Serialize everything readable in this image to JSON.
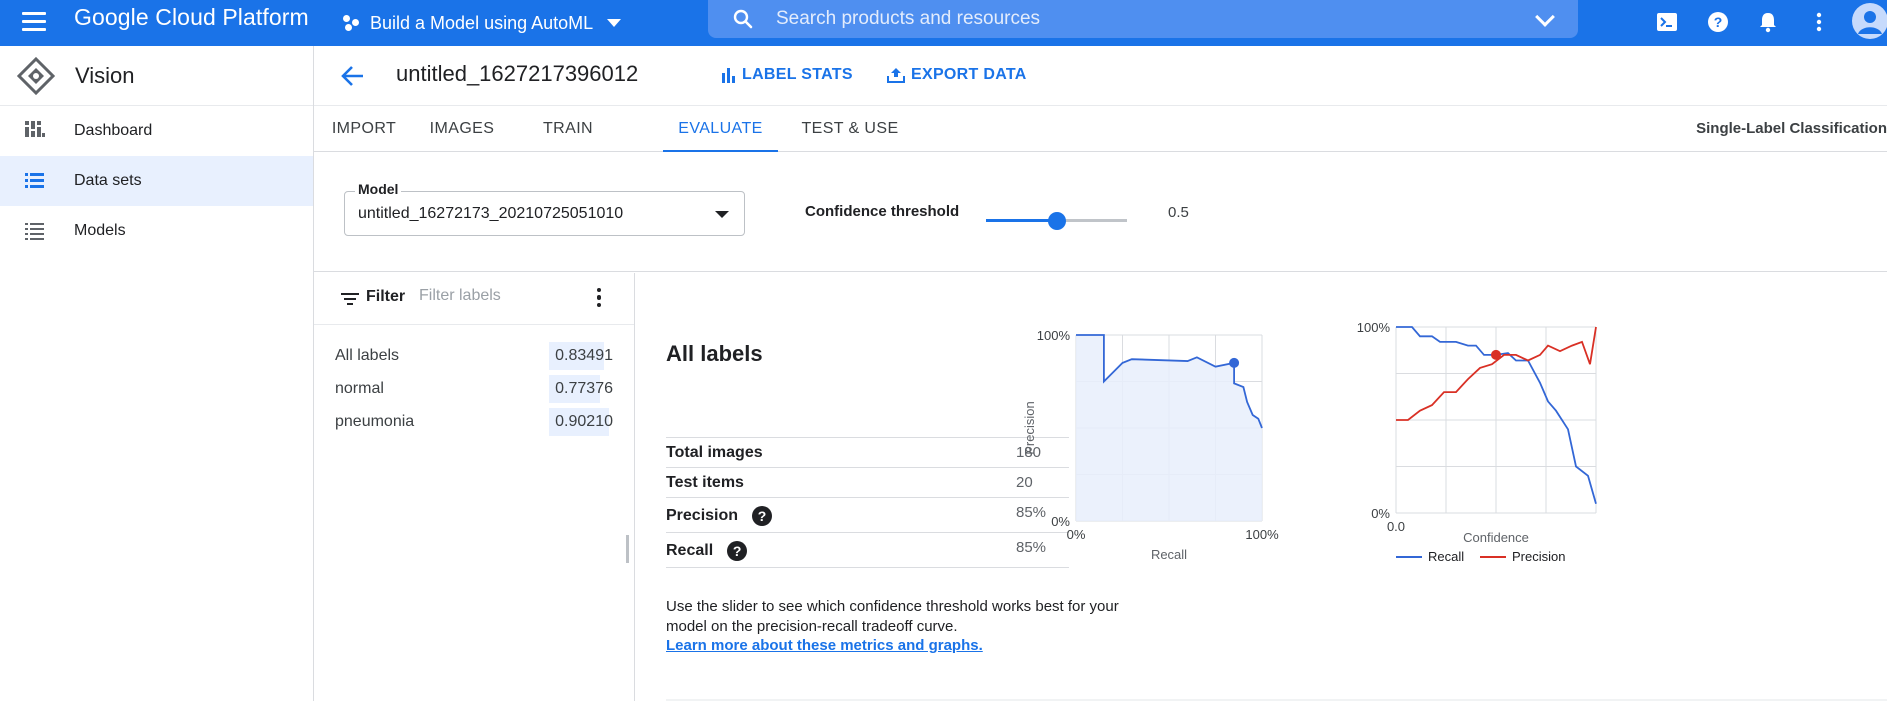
{
  "topbar": {
    "brand": "Google Cloud Platform",
    "project": "Build a Model using AutoML",
    "search_placeholder": "Search products and resources",
    "icons": [
      "cloud-shell-icon",
      "help-icon",
      "notifications-icon",
      "more-vert-icon",
      "account-avatar-icon"
    ],
    "color": "#1a73e8"
  },
  "leftnav": {
    "title": "Vision",
    "items": [
      {
        "label": "Dashboard",
        "icon": "dashboard-icon",
        "active": false
      },
      {
        "label": "Data sets",
        "icon": "datasets-icon",
        "active": true
      },
      {
        "label": "Models",
        "icon": "models-icon",
        "active": false
      }
    ]
  },
  "header": {
    "dataset_title": "untitled_1627217396012",
    "label_stats": "LABEL STATS",
    "export_data": "EXPORT DATA"
  },
  "tabs": {
    "items": [
      "IMPORT",
      "IMAGES",
      "TRAIN",
      "EVALUATE",
      "TEST & USE"
    ],
    "active": "EVALUATE",
    "right_label": "Single-Label Classification"
  },
  "model": {
    "label": "Model",
    "value": "untitled_16272173_20210725051010",
    "confidence_label": "Confidence threshold",
    "confidence_value": "0.5",
    "confidence_fraction": 0.5
  },
  "filter": {
    "label": "Filter",
    "placeholder": "Filter labels",
    "labels": [
      {
        "name": "All labels",
        "score": "0.83491",
        "fraction": 0.83491
      },
      {
        "name": "normal",
        "score": "0.77376",
        "fraction": 0.77376
      },
      {
        "name": "pneumonia",
        "score": "0.90210",
        "fraction": 0.9021
      }
    ]
  },
  "summary": {
    "heading": "All labels",
    "rows": [
      {
        "key": "Total images",
        "value": "180",
        "help": false
      },
      {
        "key": "Test items",
        "value": "20",
        "help": false
      },
      {
        "key": "Precision",
        "value": "85%",
        "help": true
      },
      {
        "key": "Recall",
        "value": "85%",
        "help": true
      }
    ],
    "help_text": "Use the slider to see which confidence threshold works best for your model on the precision-recall tradeoff curve.",
    "help_link": "Learn more about these metrics and graphs."
  },
  "chart_data": [
    {
      "type": "area",
      "xlabel": "Recall",
      "ylabel": "Precision",
      "x_ticks": [
        "0%",
        "100%"
      ],
      "y_ticks": [
        "0%",
        "100%"
      ],
      "xlim": [
        0,
        1
      ],
      "ylim": [
        0,
        1
      ],
      "grid": true,
      "color": "#3367d6",
      "series": [
        {
          "x": [
            0,
            0.15,
            0.15,
            0.25,
            0.3,
            0.6,
            0.65,
            0.75,
            0.85,
            0.85,
            0.9,
            0.92,
            0.95,
            0.98,
            1.0
          ],
          "y": [
            1.0,
            1.0,
            0.75,
            0.85,
            0.87,
            0.86,
            0.88,
            0.83,
            0.85,
            0.74,
            0.72,
            0.64,
            0.57,
            0.55,
            0.5
          ]
        }
      ],
      "marker": {
        "x": 0.85,
        "y": 0.85
      }
    },
    {
      "type": "line",
      "xlabel": "Confidence",
      "x_ticks": [
        "0.0"
      ],
      "y_ticks": [
        "0%",
        "100%"
      ],
      "xlim": [
        0,
        1
      ],
      "ylim": [
        0,
        1
      ],
      "grid": true,
      "legend": "bottom",
      "series": [
        {
          "name": "Recall",
          "color": "#3367d6",
          "x": [
            0,
            0.08,
            0.12,
            0.18,
            0.22,
            0.3,
            0.36,
            0.4,
            0.44,
            0.5,
            0.56,
            0.6,
            0.66,
            0.72,
            0.76,
            0.8,
            0.86,
            0.9,
            0.96,
            1.0
          ],
          "y": [
            1.0,
            1.0,
            0.95,
            0.95,
            0.92,
            0.92,
            0.9,
            0.9,
            0.85,
            0.85,
            0.86,
            0.82,
            0.82,
            0.7,
            0.6,
            0.55,
            0.45,
            0.25,
            0.2,
            0.05
          ]
        },
        {
          "name": "Precision",
          "color": "#d93025",
          "x": [
            0,
            0.06,
            0.12,
            0.18,
            0.24,
            0.3,
            0.36,
            0.42,
            0.48,
            0.54,
            0.6,
            0.66,
            0.72,
            0.76,
            0.82,
            0.88,
            0.93,
            0.97,
            1.0
          ],
          "y": [
            0.5,
            0.5,
            0.55,
            0.58,
            0.65,
            0.65,
            0.72,
            0.78,
            0.8,
            0.85,
            0.85,
            0.82,
            0.85,
            0.9,
            0.87,
            0.9,
            0.92,
            0.8,
            1.0
          ]
        }
      ],
      "marker": {
        "x": 0.5,
        "y": 0.85,
        "color": "#d93025"
      }
    }
  ]
}
